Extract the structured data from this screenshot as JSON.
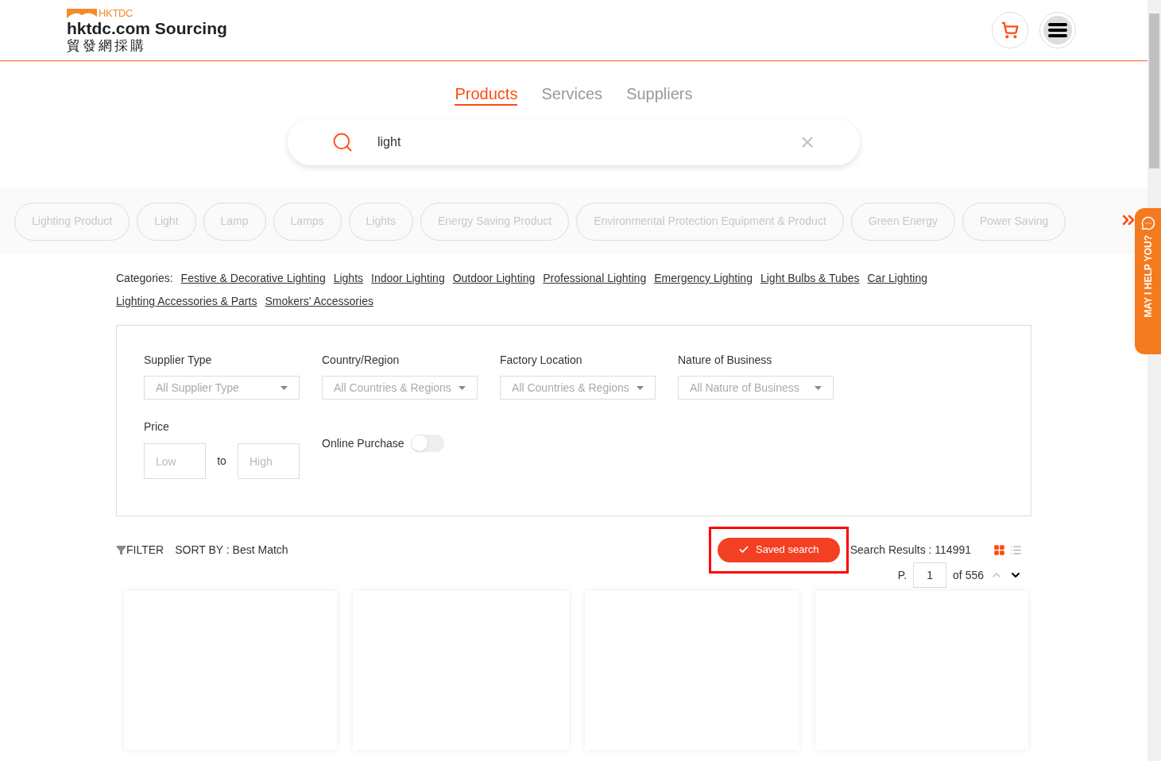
{
  "logo": {
    "brand": "HKTDC",
    "name": "hktdc.com Sourcing",
    "name_zh": "貿發網採購"
  },
  "tabs": [
    {
      "label": "Products",
      "selected": true
    },
    {
      "label": "Services",
      "selected": false
    },
    {
      "label": "Suppliers",
      "selected": false
    }
  ],
  "search": {
    "value": "light"
  },
  "keywords": [
    "Lighting Product",
    "Light",
    "Lamp",
    "Lamps",
    "Lights",
    "Energy Saving Product",
    "Environmental Protection Equipment & Product",
    "Green Energy",
    "Power Saving"
  ],
  "categories": {
    "label": "Categories:",
    "links": [
      "Festive & Decorative Lighting",
      "Lights",
      "Indoor Lighting",
      "Outdoor Lighting",
      "Professional Lighting",
      "Emergency Lighting",
      "Light Bulbs & Tubes",
      "Car Lighting",
      "Lighting Accessories & Parts",
      "Smokers' Accessories"
    ]
  },
  "filters": {
    "selects": [
      {
        "label": "Supplier Type",
        "value": "All Supplier Type"
      },
      {
        "label": "Country/Region",
        "value": "All Countries & Regions"
      },
      {
        "label": "Factory Location",
        "value": "All Countries & Regions"
      },
      {
        "label": "Nature of Business",
        "value": "All Nature of Business"
      }
    ],
    "price": {
      "label": "Price",
      "low_placeholder": "Low",
      "to": "to",
      "high_placeholder": "High"
    },
    "online_purchase": {
      "label": "Online Purchase",
      "on": false
    }
  },
  "toolbar": {
    "filter": "FILTER",
    "sort": "SORT BY : Best Match",
    "saved_search": {
      "label": "Saved search",
      "highlighted": true
    },
    "results": "Search Results : 114991",
    "views": [
      {
        "kind": "grid",
        "selected": true
      },
      {
        "kind": "list",
        "selected": false
      }
    ]
  },
  "pagination": {
    "prefix": "P.",
    "page": "1",
    "total": "of 556"
  },
  "help_tab": "MAY I HELP YOU?"
}
